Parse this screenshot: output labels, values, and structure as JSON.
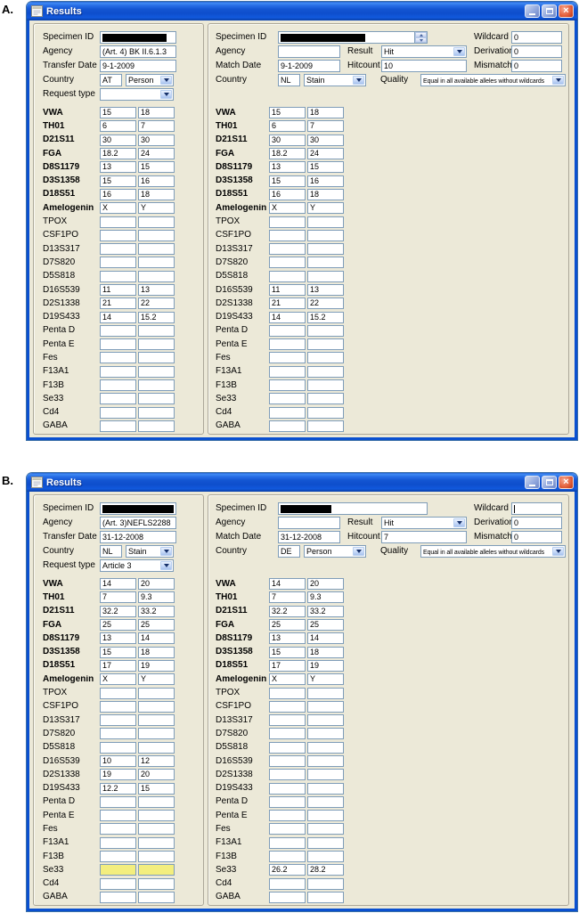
{
  "labels": {
    "specimen_id": "Specimen ID",
    "agency": "Agency",
    "transfer_date": "Transfer Date",
    "match_date": "Match Date",
    "country": "Country",
    "request_type": "Request type",
    "result": "Result",
    "hitcount": "Hitcount",
    "quality": "Quality",
    "wildcard": "Wildcard",
    "derivation": "Derivation",
    "mismatch": "Mismatch"
  },
  "icons": {
    "window": "form-icon",
    "minimize": "minimize-icon",
    "maximize": "maximize-icon",
    "close_glyph": "×",
    "combo_arrow": "chevron-down-icon",
    "spinner": "up-down-spinner-icon"
  },
  "colors": {
    "titlebar_blue": "#0A50D0",
    "client_bg": "#ECE9D8",
    "field_border": "#7F9DB9",
    "group_border": "#ACA899",
    "highlight_yellow": "#F3EE7E",
    "close_button_red": "#D44A26",
    "redaction_black": "#000000"
  },
  "windows": [
    {
      "fig": "A.",
      "title": "Results",
      "left": {
        "agency": "(Art. 4) BK II.6.1.3",
        "date": "9-1-2009",
        "country_code": "AT",
        "country_type": "Person",
        "request": ""
      },
      "right": {
        "agency": "",
        "date": "9-1-2009",
        "country_code": "NL",
        "country_type": "Stain",
        "result": "Hit",
        "hitcount": "10",
        "quality": "Equal in all available alleles without wildcards",
        "wildcard": "0",
        "derivation": "0",
        "mismatch": "0"
      },
      "loci": [
        {
          "name": "VWA",
          "bold": true,
          "l1": "15",
          "l2": "18",
          "r1": "15",
          "r2": "18"
        },
        {
          "name": "TH01",
          "bold": true,
          "l1": "6",
          "l2": "7",
          "r1": "6",
          "r2": "7"
        },
        {
          "name": "D21S11",
          "bold": true,
          "l1": "30",
          "l2": "30",
          "r1": "30",
          "r2": "30"
        },
        {
          "name": "FGA",
          "bold": true,
          "l1": "18.2",
          "l2": "24",
          "r1": "18.2",
          "r2": "24"
        },
        {
          "name": "D8S1179",
          "bold": true,
          "l1": "13",
          "l2": "15",
          "r1": "13",
          "r2": "15"
        },
        {
          "name": "D3S1358",
          "bold": true,
          "l1": "15",
          "l2": "16",
          "r1": "15",
          "r2": "16"
        },
        {
          "name": "D18S51",
          "bold": true,
          "l1": "16",
          "l2": "18",
          "r1": "16",
          "r2": "18"
        },
        {
          "name": "Amelogenin",
          "bold": true,
          "l1": "X",
          "l2": "Y",
          "r1": "X",
          "r2": "Y"
        },
        {
          "name": "TPOX"
        },
        {
          "name": "CSF1PO"
        },
        {
          "name": "D13S317"
        },
        {
          "name": "D7S820"
        },
        {
          "name": "D5S818"
        },
        {
          "name": "D16S539",
          "l1": "11",
          "l2": "13",
          "r1": "11",
          "r2": "13"
        },
        {
          "name": "D2S1338",
          "l1": "21",
          "l2": "22",
          "r1": "21",
          "r2": "22"
        },
        {
          "name": "D19S433",
          "l1": "14",
          "l2": "15.2",
          "r1": "14",
          "r2": "15.2"
        },
        {
          "name": "Penta D"
        },
        {
          "name": "Penta E"
        },
        {
          "name": "Fes"
        },
        {
          "name": "F13A1"
        },
        {
          "name": "F13B"
        },
        {
          "name": "Se33"
        },
        {
          "name": "Cd4"
        },
        {
          "name": "GABA"
        }
      ]
    },
    {
      "fig": "B.",
      "title": "Results",
      "left": {
        "agency": "(Art. 3)NEFLS2288",
        "date": "31-12-2008",
        "country_code": "NL",
        "country_type": "Stain",
        "request": "Article 3"
      },
      "right": {
        "agency": "",
        "date": "31-12-2008",
        "country_code": "DE",
        "country_type": "Person",
        "result": "Hit",
        "hitcount": "7",
        "quality": "Equal in all available alleles without wildcards",
        "wildcard": "",
        "derivation": "0",
        "mismatch": "0"
      },
      "loci": [
        {
          "name": "VWA",
          "bold": true,
          "l1": "14",
          "l2": "20",
          "r1": "14",
          "r2": "20"
        },
        {
          "name": "TH01",
          "bold": true,
          "l1": "7",
          "l2": "9.3",
          "r1": "7",
          "r2": "9.3"
        },
        {
          "name": "D21S11",
          "bold": true,
          "l1": "32.2",
          "l2": "33.2",
          "r1": "32.2",
          "r2": "33.2"
        },
        {
          "name": "FGA",
          "bold": true,
          "l1": "25",
          "l2": "25",
          "r1": "25",
          "r2": "25"
        },
        {
          "name": "D8S1179",
          "bold": true,
          "l1": "13",
          "l2": "14",
          "r1": "13",
          "r2": "14"
        },
        {
          "name": "D3S1358",
          "bold": true,
          "l1": "15",
          "l2": "18",
          "r1": "15",
          "r2": "18"
        },
        {
          "name": "D18S51",
          "bold": true,
          "l1": "17",
          "l2": "19",
          "r1": "17",
          "r2": "19"
        },
        {
          "name": "Amelogenin",
          "bold": true,
          "l1": "X",
          "l2": "Y",
          "r1": "X",
          "r2": "Y"
        },
        {
          "name": "TPOX"
        },
        {
          "name": "CSF1PO"
        },
        {
          "name": "D13S317"
        },
        {
          "name": "D7S820"
        },
        {
          "name": "D5S818"
        },
        {
          "name": "D16S539",
          "l1": "10",
          "l2": "12"
        },
        {
          "name": "D2S1338",
          "l1": "19",
          "l2": "20"
        },
        {
          "name": "D19S433",
          "l1": "12.2",
          "l2": "15"
        },
        {
          "name": "Penta D"
        },
        {
          "name": "Penta E"
        },
        {
          "name": "Fes"
        },
        {
          "name": "F13A1"
        },
        {
          "name": "F13B"
        },
        {
          "name": "Se33",
          "lhl": true,
          "r1": "26.2",
          "r2": "28.2"
        },
        {
          "name": "Cd4"
        },
        {
          "name": "GABA"
        }
      ]
    }
  ]
}
